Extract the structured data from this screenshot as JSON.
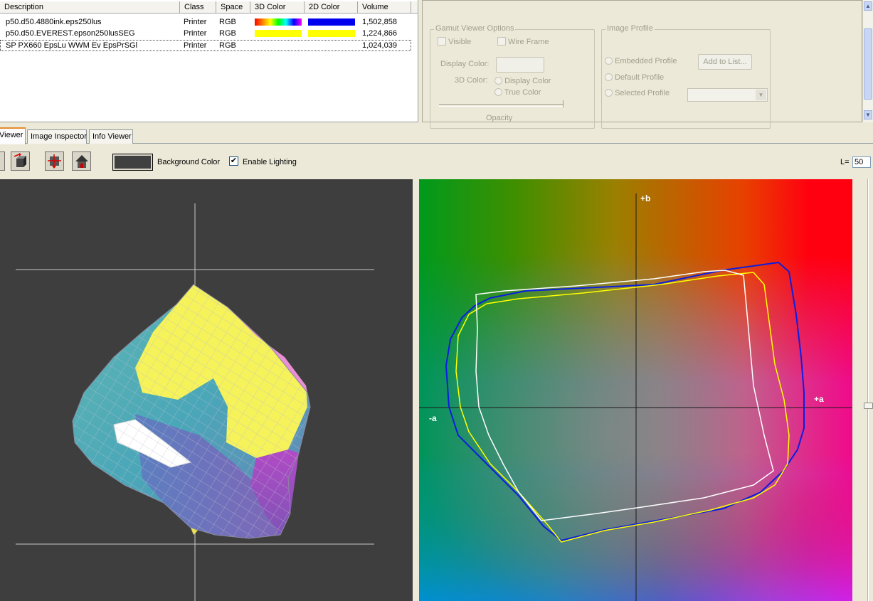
{
  "profiles": {
    "columns": [
      "Description",
      "Class",
      "Space",
      "3D Color",
      "2D Color",
      "Volume"
    ],
    "rows": [
      {
        "description": "p50.d50.4880ink.eps250lus",
        "class": "Printer",
        "space": "RGB",
        "color3d": "rainbow",
        "color2d": "#0000ee",
        "volume": "1,502,858"
      },
      {
        "description": "p50.d50.EVEREST.epson250lusSEG",
        "class": "Printer",
        "space": "RGB",
        "color3d": "#ffff00",
        "color2d": "#ffff00",
        "volume": "1,224,866"
      },
      {
        "description": "SP PX660 EpsLu WWM Ev EpsPrSGl",
        "class": "Printer",
        "space": "RGB",
        "color3d": "",
        "color2d": "",
        "volume": "1,024,039"
      }
    ]
  },
  "gamut_options": {
    "title": "Gamut Viewer Options",
    "visible_label": "Visible",
    "wireframe_label": "Wire Frame",
    "display_color_label": "Display Color:",
    "color3d_label": "3D Color:",
    "radio_display_color": "Display Color",
    "radio_true_color": "True Color",
    "opacity_label": "Opacity"
  },
  "image_profile": {
    "title": "Image Profile",
    "embedded": "Embedded Profile",
    "default": "Default Profile",
    "selected": "Selected Profile",
    "add_button": "Add to List..."
  },
  "tabs": [
    {
      "label": "Viewer",
      "active": true
    },
    {
      "label": "Image Inspector",
      "active": false
    },
    {
      "label": "Info Viewer",
      "active": false
    }
  ],
  "toolbar": {
    "background_color_label": "Background Color",
    "background_color": "#404040",
    "enable_lighting_label": "Enable Lighting",
    "enable_lighting_checked": true,
    "l_label": "L=",
    "l_value": "50"
  },
  "view2d": {
    "plus_b": "+b",
    "minus_a": "-a",
    "plus_a": "+a"
  },
  "colors": {
    "blue_gamut": "#0a1ee0",
    "yellow_gamut": "#ffff00",
    "white_gamut": "#ffffff",
    "viewer3d_background": "#3e3e3e"
  }
}
